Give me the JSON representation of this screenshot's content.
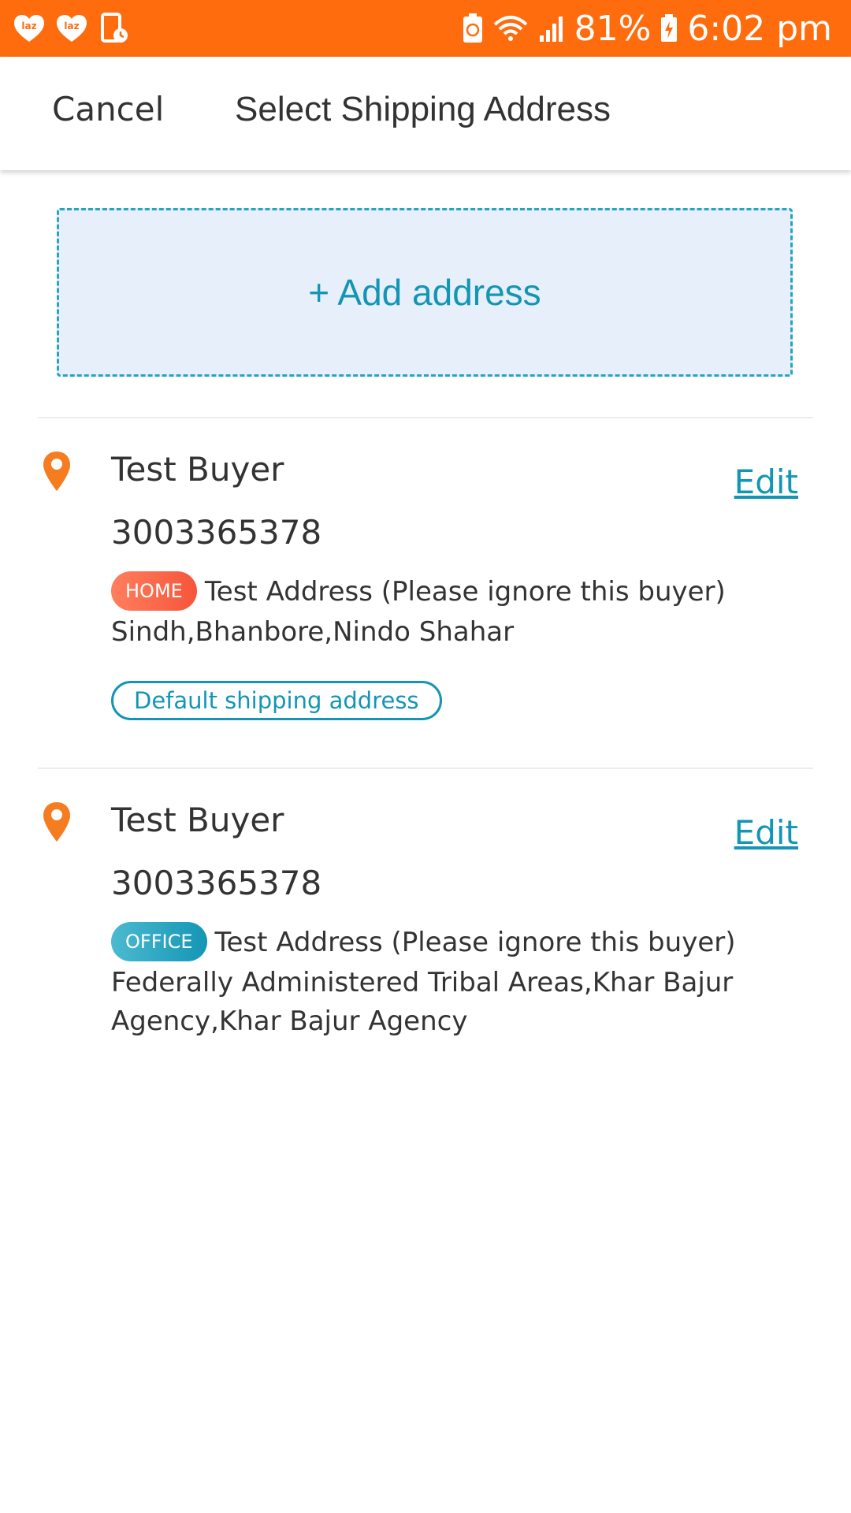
{
  "status_bar": {
    "notification_icons": [
      "laz-heart-icon",
      "laz-heart-icon",
      "phone-clock-icon"
    ],
    "battery_percent": "81%",
    "time": "6:02 pm",
    "color": "#ff6c0e"
  },
  "header": {
    "cancel_label": "Cancel",
    "title": "Select Shipping Address"
  },
  "add_address": {
    "label": "+ Add address"
  },
  "addresses": [
    {
      "name": "Test Buyer",
      "phone": "3003365378",
      "tag": "HOME",
      "line1": "Test Address (Please ignore this buyer)",
      "line2": "Sindh,Bhanbore,Nindo Shahar",
      "edit_label": "Edit",
      "default_label": "Default shipping address"
    },
    {
      "name": "Test Buyer",
      "phone": "3003365378",
      "tag": "OFFICE",
      "line1": "Test Address (Please ignore this buyer)",
      "line2": "Federally Administered Tribal Areas,Khar Bajur Agency,Khar Bajur Agency",
      "edit_label": "Edit"
    }
  ],
  "colors": {
    "accent": "#1395b5",
    "pin": "#f57c20",
    "home_tag": "#f7553a",
    "office_tag": "#1396b5"
  }
}
